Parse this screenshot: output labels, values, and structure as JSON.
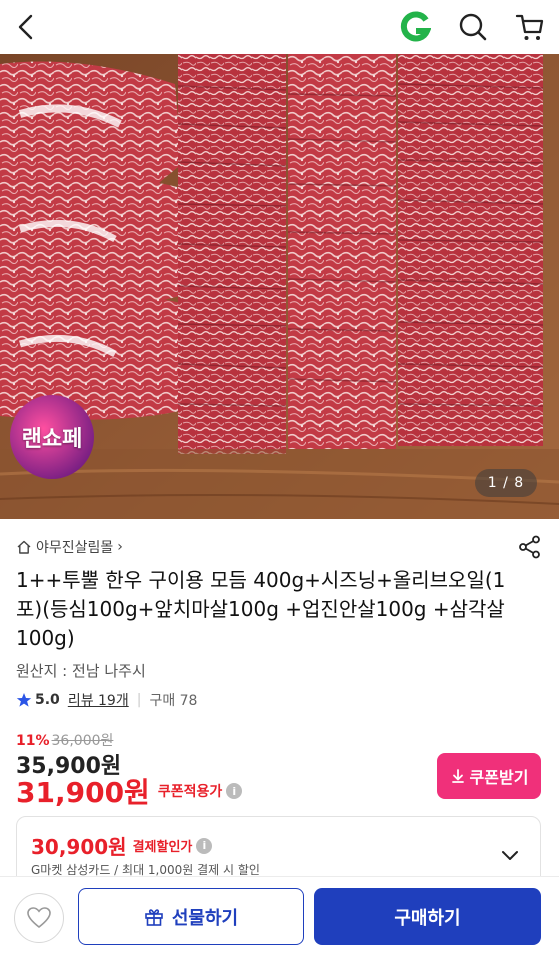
{
  "header": {
    "back_icon": "chevron-left-icon",
    "brand_logo": "G",
    "brand_color": "#23b34a",
    "search_icon": "search-icon",
    "cart_icon": "cart-icon"
  },
  "gallery": {
    "page_indicator": "1 / 8",
    "badge_text": "랜쇼페",
    "current_page": 1,
    "total_pages": 8
  },
  "product": {
    "store_name": "야무진살림몰",
    "store_chevron": "›",
    "title": "1++투뿔 한우 구이용 모듬 400g+시즈닝+올리브오일(1포)(등심100g+앞치마살100g +업진안살100g +삼각살100g)",
    "origin": "원산지 : 전남 나주시",
    "rating": "5.0",
    "review_label": "리뷰 19개",
    "separator": "|",
    "purchase_count": "구매 78"
  },
  "pricing": {
    "discount_pct": "11%",
    "original_price": "36,000원",
    "sale_price": "35,900원",
    "coupon_price": "31,900원",
    "coupon_price_label": "쿠폰적용가",
    "coupon_button": "쿠폰받기",
    "accent_color": "#e8202a",
    "coupon_button_color": "#f0307a"
  },
  "payment_discount": {
    "price": "30,900원",
    "label": "결제할인가",
    "description": "G마켓 삼성카드 / 최대 1,000원 결제 시 할인"
  },
  "bottom_bar": {
    "wish_icon": "heart-icon",
    "gift_label": "선물하기",
    "buy_label": "구매하기",
    "primary_color": "#1f3fbd"
  }
}
